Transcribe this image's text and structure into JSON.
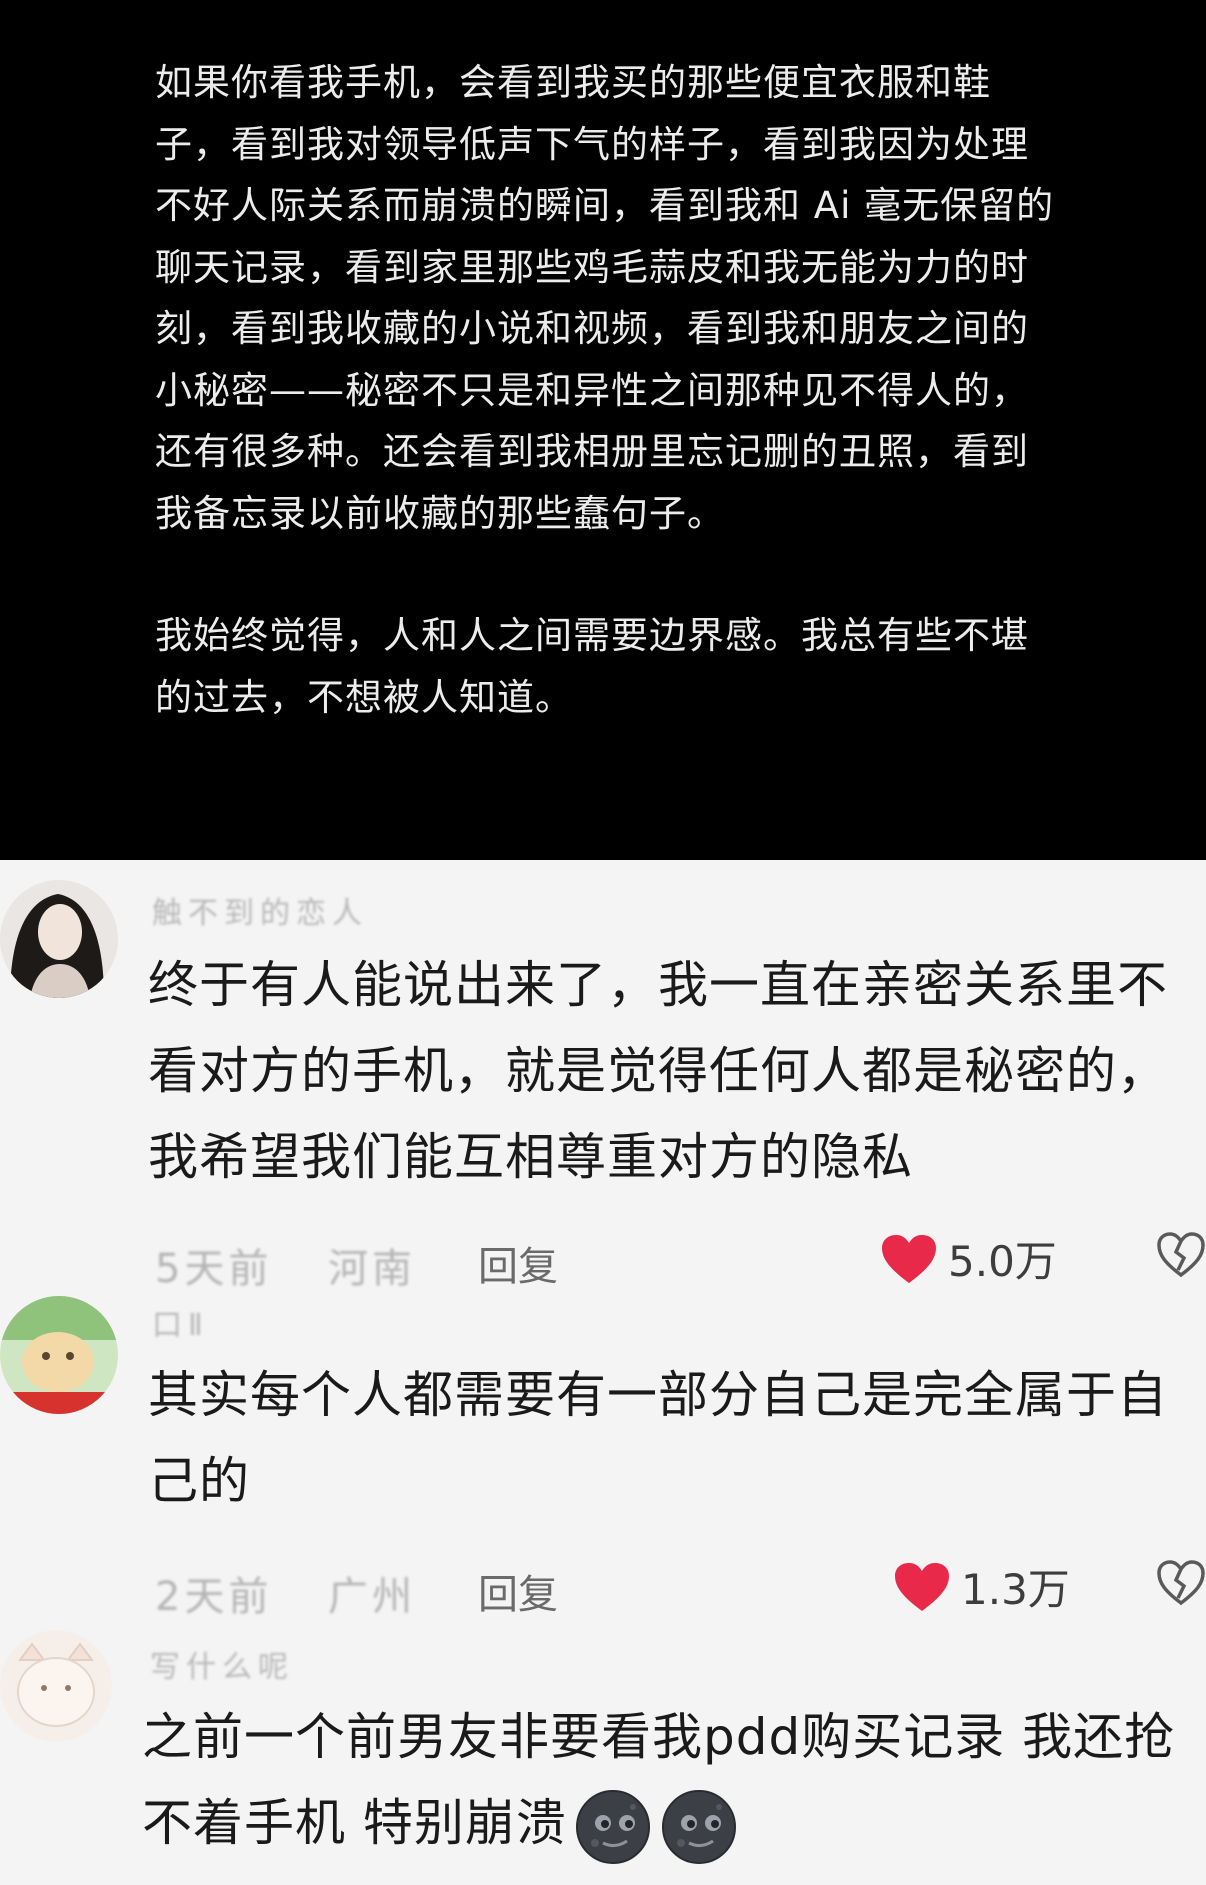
{
  "post": {
    "paragraphs": [
      "如果你看我手机，会看到我买的那些便宜衣服和鞋子，看到我对领导低声下气的样子，看到我因为处理不好人际关系而崩溃的瞬间，看到我和 Ai 毫无保留的聊天记录，看到家里那些鸡毛蒜皮和我无能为力的时刻，看到我收藏的小说和视频，看到我和朋友之间的小秘密——秘密不只是和异性之间那种见不得人的，还有很多种。还会看到我相册里忘记删的丑照，看到我备忘录以前收藏的那些蠢句子。",
      "我始终觉得，人和人之间需要边界感。我总有些不堪的过去，不想被人知道。"
    ]
  },
  "comments": [
    {
      "username": "触不到的恋人",
      "text": "终于有人能说出来了，我一直在亲密关系里不看对方的手机，就是觉得任何人都是秘密的，我希望我们能互相尊重对方的隐私",
      "date": "5天前",
      "location": "河南",
      "reply_label": "回复",
      "likes": "5.0万"
    },
    {
      "username": "口Ⅱ",
      "text": "其实每个人都需要有一部分自己是完全属于自己的",
      "date": "2天前",
      "location": "广州",
      "reply_label": "回复",
      "likes": "1.3万"
    },
    {
      "username": "写什么呢",
      "text": "之前一个前男友非要看我pdd购买记录 我还抢不着手机 特别崩溃",
      "emoji": [
        "new-moon-face-icon",
        "new-moon-face-icon"
      ]
    }
  ],
  "colors": {
    "post_bg": "#000000",
    "post_text": "#ececec",
    "comment_bg": "#f4f4f4",
    "like_heart": "#e8294a"
  }
}
